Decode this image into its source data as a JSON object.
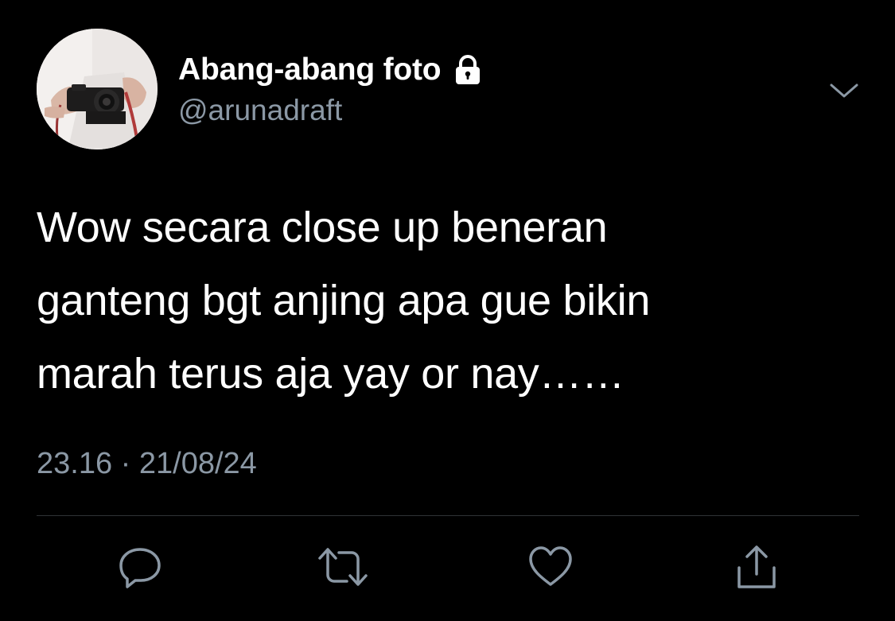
{
  "tweet": {
    "display_name": "Abang-abang foto",
    "handle": "@arunadraft",
    "text": "Wow secara close up beneran\nganteng bgt anjing apa gue bikin\nmarah terus aja yay or nay……",
    "time": "23.16",
    "separator": "·",
    "date": "21/08/24"
  },
  "icons": {
    "avatar": "profile-photo-camera",
    "lock": "lock-icon",
    "more": "chevron-down-icon",
    "reply": "reply-icon",
    "retweet": "retweet-icon",
    "like": "heart-icon",
    "share": "share-icon"
  },
  "colors": {
    "background": "#000000",
    "primary_text": "#ffffff",
    "secondary_text": "#8b98a5",
    "divider": "#2f3336"
  }
}
